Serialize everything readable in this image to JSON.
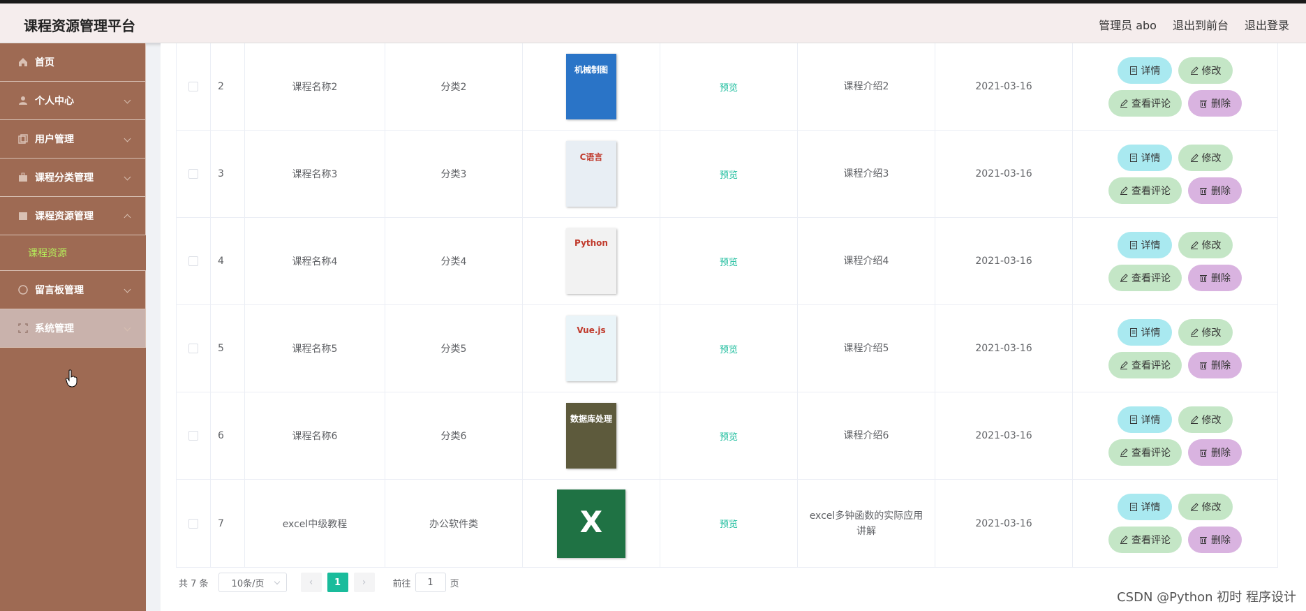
{
  "header": {
    "title": "课程资源管理平台",
    "user": "管理员 abo",
    "to_front": "退出到前台",
    "logout": "退出登录"
  },
  "sidebar": {
    "items": [
      {
        "label": "首页",
        "icon": "home-icon"
      },
      {
        "label": "个人中心",
        "icon": "user-icon"
      },
      {
        "label": "用户管理",
        "icon": "copy-icon"
      },
      {
        "label": "课程分类管理",
        "icon": "briefcase-icon"
      },
      {
        "label": "课程资源管理",
        "icon": "folder-icon"
      },
      {
        "label": "留言板管理",
        "icon": "chat-icon"
      },
      {
        "label": "系统管理",
        "icon": "frame-icon"
      }
    ],
    "sub_item": "课程资源"
  },
  "table": {
    "rows": [
      {
        "idx": "2",
        "name": "课程名称2",
        "category": "分类2",
        "preview": "预览",
        "intro": "课程介绍2",
        "date": "2021-03-16",
        "cover": {
          "title": "机械制图",
          "color": "#2a74c7"
        }
      },
      {
        "idx": "3",
        "name": "课程名称3",
        "category": "分类3",
        "preview": "预览",
        "intro": "课程介绍3",
        "date": "2021-03-16",
        "cover": {
          "title": "C语言",
          "color": "#e8eef4"
        }
      },
      {
        "idx": "4",
        "name": "课程名称4",
        "category": "分类4",
        "preview": "预览",
        "intro": "课程介绍4",
        "date": "2021-03-16",
        "cover": {
          "title": "Python",
          "color": "#f2f2f2"
        }
      },
      {
        "idx": "5",
        "name": "课程名称5",
        "category": "分类5",
        "preview": "预览",
        "intro": "课程介绍5",
        "date": "2021-03-16",
        "cover": {
          "title": "Vue.js",
          "color": "#eaf4f8"
        }
      },
      {
        "idx": "6",
        "name": "课程名称6",
        "category": "分类6",
        "preview": "预览",
        "intro": "课程介绍6",
        "date": "2021-03-16",
        "cover": {
          "title": "数据库处理",
          "color": "#5d5a3c"
        }
      },
      {
        "idx": "7",
        "name": "excel中级教程",
        "category": "办公软件类",
        "preview": "预览",
        "intro": "excel多钟函数的实际应用讲解",
        "date": "2021-03-16",
        "cover": {
          "title": "X",
          "color": "#1f7244"
        }
      }
    ],
    "actions": {
      "detail": "详情",
      "edit": "修改",
      "comment": "查看评论",
      "delete": "删除"
    }
  },
  "pagination": {
    "total": "共 7 条",
    "page_size": "10条/页",
    "current_page": "1",
    "goto_label": "前往",
    "goto_value": "1",
    "page_suffix": "页"
  },
  "watermark": "CSDN @Python 初时 程序设计"
}
